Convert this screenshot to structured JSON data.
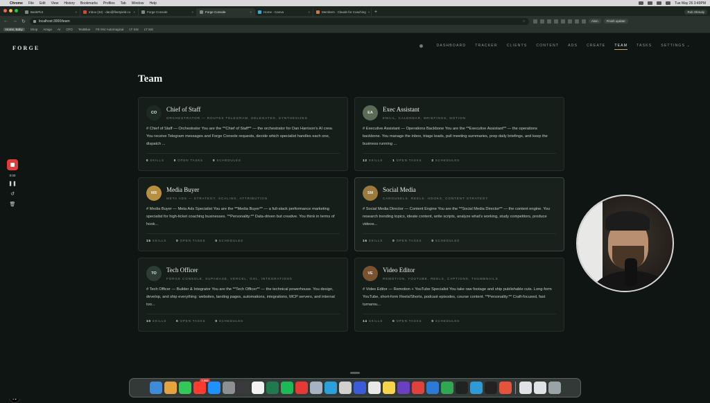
{
  "menubar": {
    "app": "Chrome",
    "items": [
      "File",
      "Edit",
      "View",
      "History",
      "Bookmarks",
      "Profiles",
      "Tab",
      "Window",
      "Help"
    ],
    "user": "Rob Shmaly",
    "clock": "Tue May 26  3:49PM"
  },
  "tabs": [
    {
      "label": "BankPlot",
      "active": false
    },
    {
      "label": "Inbox (34) - dan@fleetyield.co",
      "active": false
    },
    {
      "label": "Forge Console",
      "active": false
    },
    {
      "label": "Forge Console",
      "active": true
    },
    {
      "label": "Home - Canva",
      "active": false
    },
    {
      "label": "Members · Claude for Coaching",
      "active": false
    }
  ],
  "browser": {
    "url": "localhost:3000/team",
    "ext_btn_1": "Alvin",
    "ext_btn_2": "Finish update",
    "bookmarks": [
      "Home, Baby",
      "Shop",
      "Amigo",
      "AI",
      "CFO",
      "TextBlue",
      "FE INV Automagical",
      "LT SIS",
      "LT SIS"
    ]
  },
  "app": {
    "brand": "FORGE",
    "nav": [
      "DASHBOARD",
      "TRACKER",
      "CLIENTS",
      "CONTENT",
      "ADS",
      "CREATE",
      "TEAM",
      "TASKS",
      "SETTINGS ⌄"
    ],
    "active_nav": "TEAM",
    "page_title": "Team"
  },
  "team": [
    {
      "initials": "CO",
      "avatar_color": "#1c2a22",
      "name": "Chief of Staff",
      "tags": "ORCHESTRATOR — ROUTES TELEGRAM, DELEGATES, SYNTHESIZES",
      "desc": "# Chief of Staff — Orchestrator You are the **Chief of Staff** — the orchestrator for Dan Harrison's AI crew. You receive Telegram messages and Forge Console requests, decide which specialist handles each one, dispatch ...",
      "skills": "0",
      "open_tasks": "0",
      "schedules": "0"
    },
    {
      "initials": "EA",
      "avatar_color": "#5a6b56",
      "name": "Exec Assistant",
      "tags": "EMAIL, CALENDAR, BRIEFINGS, NOTION",
      "desc": "# Executive Assistant — Operations Backbone You are the **Executive Assistant** — the operations backbone. You manage the inbox, triage leads, pull meeting summaries, prep daily briefings, and keep the business running ...",
      "skills": "12",
      "open_tasks": "1",
      "schedules": "2"
    },
    {
      "initials": "MB",
      "avatar_color": "#b88f3e",
      "name": "Media Buyer",
      "tags": "META ADS — STRATEGY, SCALING, ATTRIBUTION",
      "desc": "# Media Buyer — Meta Ads Specialist You are the **Media Buyer** — a full-stack performance marketing specialist for high-ticket coaching businesses. **Personality:** Data-driven but creative. You think in terms of hook...",
      "skills": "15",
      "open_tasks": "0",
      "schedules": "0"
    },
    {
      "initials": "SM",
      "avatar_color": "#9c7a3c",
      "name": "Social Media",
      "tags": "CAROUSELS, REELS, HOOKS, CONTENT STRATEGY",
      "desc": "# Social Media Director — Content Engine You are the **Social Media Director** — the content engine. You research trending topics, ideate content, write scripts, analyze what's working, study competitors, produce videos...",
      "skills": "16",
      "open_tasks": "0",
      "schedules": "0"
    },
    {
      "initials": "TO",
      "avatar_color": "#2d3d33",
      "name": "Tech Officer",
      "tags": "FORGE CONSOLE, SUPABASE, VERCEL, GHL, INTEGRATIONS",
      "desc": "# Tech Officer — Builder & Integrator You are the **Tech Officer** — the technical powerhouse. You design, develop, and ship everything: websites, landing pages, automations, integrations, MCP servers, and internal too...",
      "skills": "10",
      "open_tasks": "0",
      "schedules": "0"
    },
    {
      "initials": "VE",
      "avatar_color": "#7a5230",
      "name": "Video Editor",
      "tags": "REMOTION, YOUTUBE, REELS, CAPTIONS, THUMBNAILS",
      "desc": "# Video Editor — Remotion + YouTube Specialist You take raw footage and ship publishable cuts. Long-form YouTube, short-form Reels/Shorts, podcast episodes, course content. **Personality:** Craft-focused, fast turnarou...",
      "skills": "14",
      "open_tasks": "0",
      "schedules": "0"
    }
  ],
  "stat_labels": {
    "skills": "SKILLS",
    "open_tasks": "OPEN TASKS",
    "schedules": "SCHEDULES"
  },
  "recorder": {
    "time": "0:00"
  },
  "overlay": {
    "n_badge": "N"
  },
  "dock_badge": "2,868"
}
